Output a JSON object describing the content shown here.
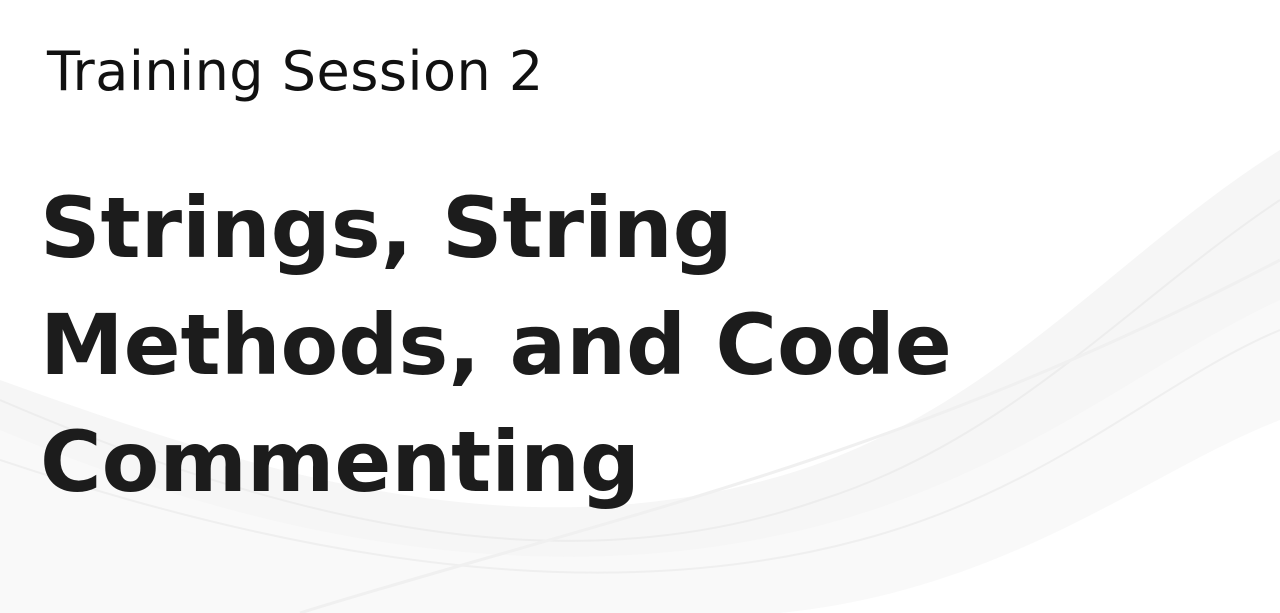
{
  "slide": {
    "subtitle": "Training Session 2",
    "title_lines": [
      "Strings, String",
      "Methods, and Code",
      "Commenting"
    ]
  },
  "colors": {
    "background": "#ffffff",
    "text": "#1c1c1c",
    "wave": "#f1f1f1"
  }
}
